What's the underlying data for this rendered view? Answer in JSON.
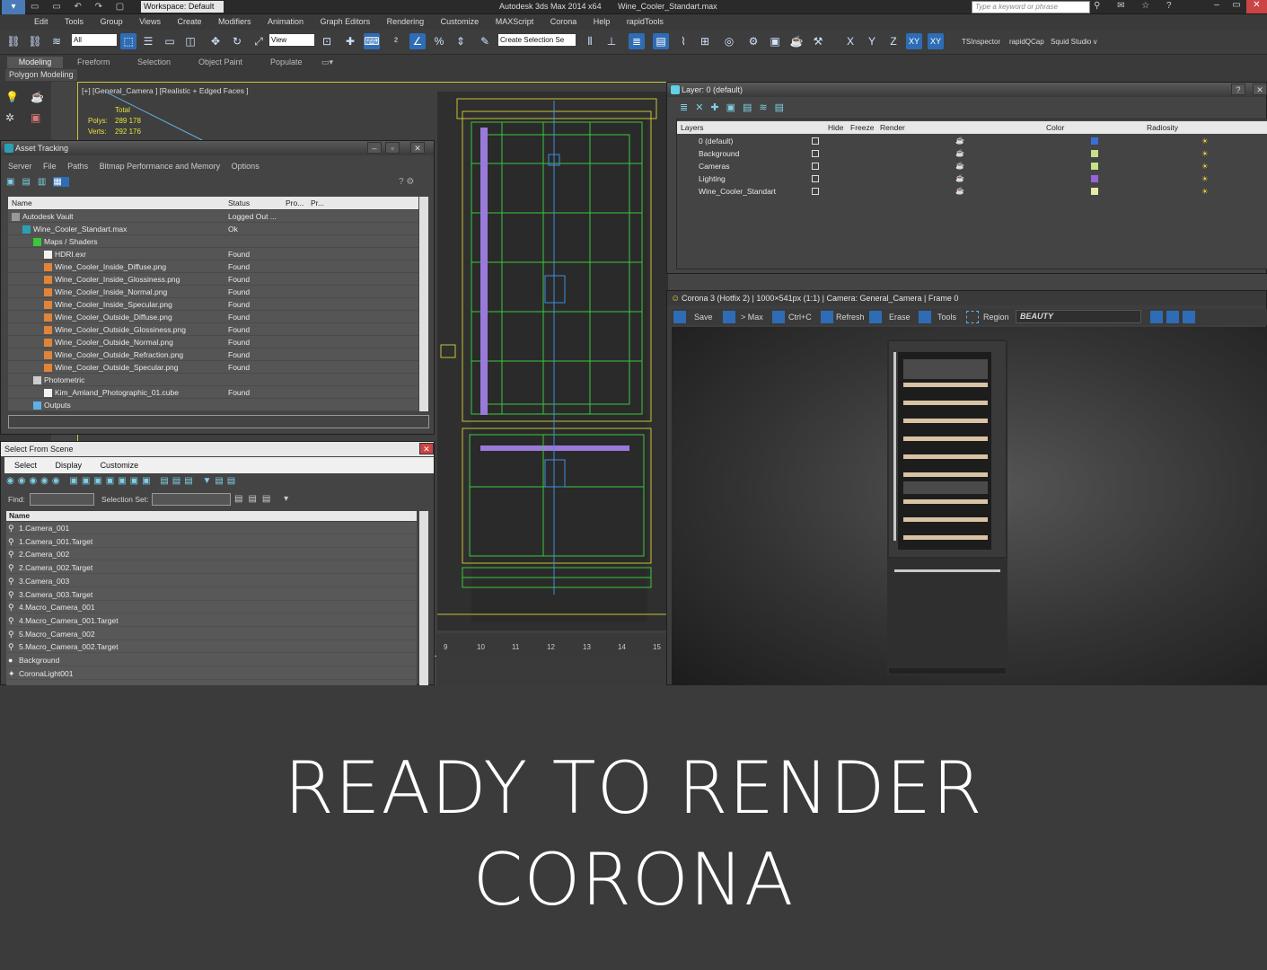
{
  "app": {
    "title": "Autodesk 3ds Max  2014 x64",
    "file": "Wine_Cooler_Standart.max",
    "workspace": "Workspace: Default",
    "search_placeholder": "Type a keyword or phrase"
  },
  "menu": [
    "Edit",
    "Tools",
    "Group",
    "Views",
    "Create",
    "Modifiers",
    "Animation",
    "Graph Editors",
    "Rendering",
    "Customize",
    "MAXScript",
    "Corona",
    "Help",
    "rapidTools"
  ],
  "toolbar": {
    "filter_select": "All",
    "ref_coord": "View",
    "selection_set": "Create Selection Se",
    "axes": [
      "X",
      "Y",
      "Z",
      "XY",
      "XY"
    ],
    "plugins": [
      "TSInspector",
      "rapidQCap",
      "Squid Studio v"
    ]
  },
  "ribbon": {
    "tabs": [
      "Modeling",
      "Freeform",
      "Selection",
      "Object Paint",
      "Populate"
    ],
    "subtab": "Polygon Modeling"
  },
  "viewport": {
    "label": "[+] [General_Camera ] [Realistic + Edged Faces ]",
    "stats_total": "Total",
    "polys_label": "Polys:",
    "polys_value": "289 178",
    "verts_label": "Verts:",
    "verts_value": "292 176",
    "ruler": [
      "9",
      "10",
      "11",
      "12",
      "13",
      "14",
      "15"
    ]
  },
  "asset_tracking": {
    "title": "Asset Tracking",
    "menu": [
      "Server",
      "File",
      "Paths",
      "Bitmap Performance and Memory",
      "Options"
    ],
    "columns": [
      "Name",
      "Status",
      "Pro...",
      "Pr..."
    ],
    "rows": [
      {
        "name": "Autodesk Vault",
        "status": "Logged Out ...",
        "indent": 0,
        "icon": "vault"
      },
      {
        "name": "Wine_Cooler_Standart.max",
        "status": "Ok",
        "indent": 1,
        "icon": "max"
      },
      {
        "name": "Maps / Shaders",
        "status": "",
        "indent": 2,
        "icon": "maps"
      },
      {
        "name": "HDRI.exr",
        "status": "Found",
        "indent": 3,
        "icon": "file"
      },
      {
        "name": "Wine_Cooler_Inside_Diffuse.png",
        "status": "Found",
        "indent": 3,
        "icon": "img"
      },
      {
        "name": "Wine_Cooler_Inside_Glossiness.png",
        "status": "Found",
        "indent": 3,
        "icon": "img"
      },
      {
        "name": "Wine_Cooler_Inside_Normal.png",
        "status": "Found",
        "indent": 3,
        "icon": "img"
      },
      {
        "name": "Wine_Cooler_Inside_Specular.png",
        "status": "Found",
        "indent": 3,
        "icon": "img"
      },
      {
        "name": "Wine_Cooler_Outside_Diffuse.png",
        "status": "Found",
        "indent": 3,
        "icon": "img"
      },
      {
        "name": "Wine_Cooler_Outside_Glossiness.png",
        "status": "Found",
        "indent": 3,
        "icon": "img"
      },
      {
        "name": "Wine_Cooler_Outside_Normal.png",
        "status": "Found",
        "indent": 3,
        "icon": "img"
      },
      {
        "name": "Wine_Cooler_Outside_Refraction.png",
        "status": "Found",
        "indent": 3,
        "icon": "img"
      },
      {
        "name": "Wine_Cooler_Outside_Specular.png",
        "status": "Found",
        "indent": 3,
        "icon": "img"
      },
      {
        "name": "Photometric",
        "status": "",
        "indent": 2,
        "icon": "photo"
      },
      {
        "name": "Kim_Amland_Photographic_01.cube",
        "status": "Found",
        "indent": 3,
        "icon": "file"
      },
      {
        "name": "Outputs",
        "status": "",
        "indent": 2,
        "icon": "out"
      }
    ]
  },
  "select_from_scene": {
    "title": "Select From Scene",
    "menu": [
      "Select",
      "Display",
      "Customize"
    ],
    "find_label": "Find:",
    "selset_label": "Selection Set:",
    "column": "Name",
    "items": [
      "1.Camera_001",
      "1.Camera_001.Target",
      "2.Camera_002",
      "2.Camera_002.Target",
      "3.Camera_003",
      "3.Camera_003.Target",
      "4.Macro_Camera_001",
      "4.Macro_Camera_001.Target",
      "5.Macro_Camera_002",
      "5.Macro_Camera_002.Target",
      "Background",
      "CoronaLight001"
    ]
  },
  "layer_manager": {
    "title": "Layer: 0 (default)",
    "columns": [
      "Layers",
      "Hide",
      "Freeze",
      "Render",
      "Color",
      "Radiosity"
    ],
    "rows": [
      {
        "name": "0 (default)",
        "color": "#3a6fd8"
      },
      {
        "name": "Background",
        "color": "#c8e08a"
      },
      {
        "name": "Cameras",
        "color": "#c8e08a"
      },
      {
        "name": "Lighting",
        "color": "#9a62d8"
      },
      {
        "name": "Wine_Cooler_Standart",
        "color": "#e8e8a8"
      }
    ]
  },
  "corona": {
    "title": "Corona 3 (Hotfix 2) | 1000×541px (1:1) | Camera: General_Camera | Frame 0",
    "buttons": [
      "Save",
      "> Max",
      "Ctrl+C",
      "Refresh",
      "Erase",
      "Tools",
      "Region"
    ],
    "channel": "BEAUTY"
  },
  "banner": {
    "line1": "READY TO RENDER",
    "line2": "CORONA"
  }
}
